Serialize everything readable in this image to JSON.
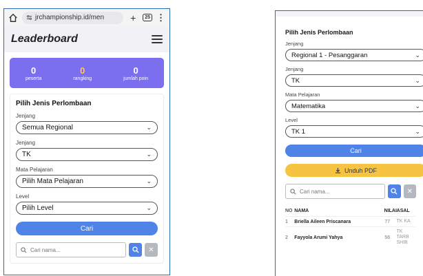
{
  "left": {
    "browser": {
      "url": "jrchampionship.id/men",
      "tab_count": "25"
    },
    "header": {
      "title": "Leaderboard"
    },
    "stats": [
      {
        "value": "0",
        "label": "peserta"
      },
      {
        "value": "0",
        "label": "rangking"
      },
      {
        "value": "0",
        "label": "jumlah poin"
      }
    ],
    "form": {
      "title": "Pilih Jenis Perlombaan",
      "jenjang1_label": "Jenjang",
      "jenjang1_value": "Semua Regional",
      "jenjang2_label": "Jenjang",
      "jenjang2_value": "TK",
      "mapel_label": "Mata Pelajaran",
      "mapel_value": "Pilih Mata Pelajaran",
      "level_label": "Level",
      "level_value": "Pilih Level",
      "cari_label": "Cari",
      "search_placeholder": "Cari nama..."
    }
  },
  "right": {
    "form": {
      "title": "Pilih Jenis Perlombaan",
      "jenjang1_label": "Jenjang",
      "jenjang1_value": "Regional 1 - Pesanggaran",
      "jenjang2_label": "Jenjang",
      "jenjang2_value": "TK",
      "mapel_label": "Mata Pelajaran",
      "mapel_value": "Matematika",
      "level_label": "Level",
      "level_value": "TK 1",
      "cari_label": "Cari",
      "pdf_label": "Unduh PDF",
      "search_placeholder": "Cari nama..."
    },
    "table": {
      "headers": [
        "NO",
        "NAMA",
        "NILAI",
        "ASAL"
      ],
      "rows": [
        {
          "no": "1",
          "nama": "Briella Aileen Priscanara",
          "nilai": "77",
          "asal": "TK KA"
        },
        {
          "no": "2",
          "nama": "Fayyola Arumi Yahya",
          "nilai": "56",
          "asal": "TK TARB SHIB"
        }
      ]
    }
  }
}
